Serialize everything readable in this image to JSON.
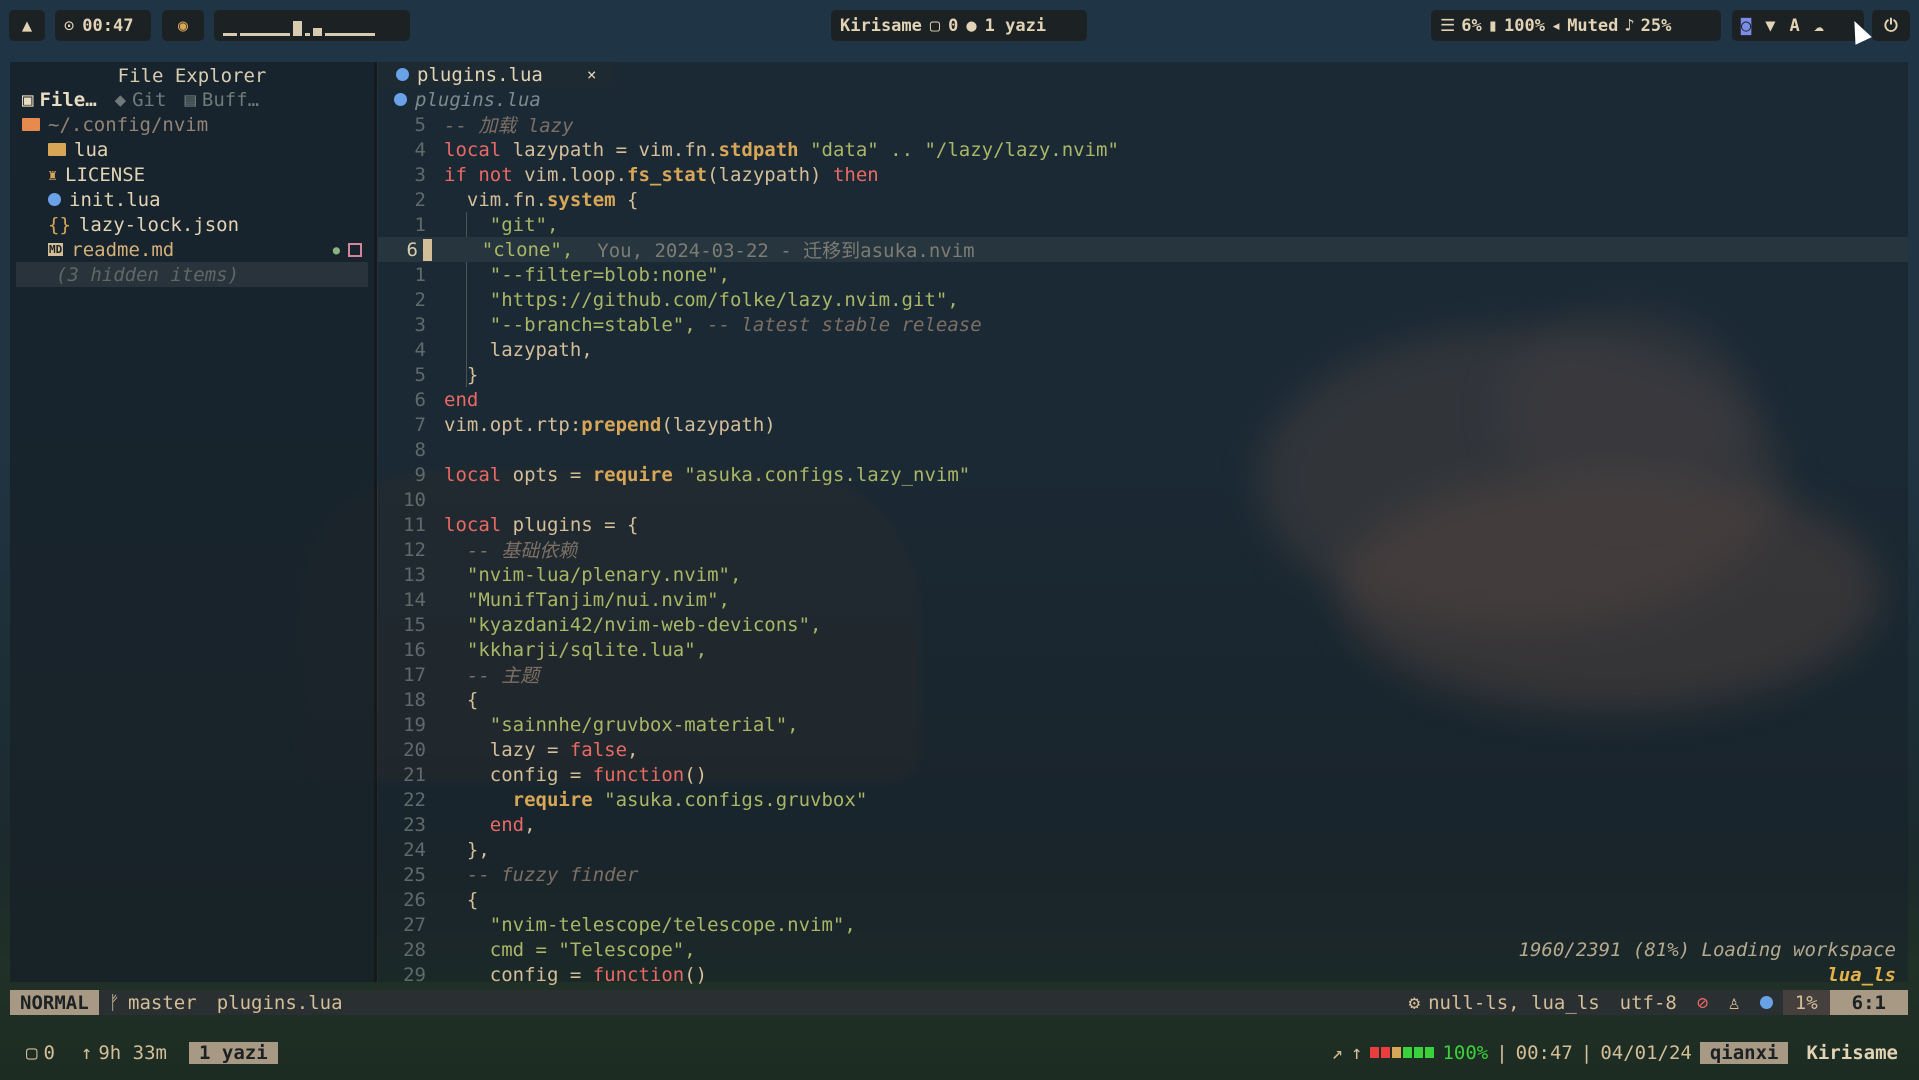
{
  "colors": {
    "accent": "#a89984",
    "keyword": "#ea6962",
    "string": "#a9b665",
    "function": "#d8a657",
    "comment": "#7c6f64",
    "battery_red": "#ea3e3e",
    "battery_green": "#3ad23a"
  },
  "topbar": {
    "clock": "00:47",
    "workspace": "Kirisame",
    "window_count": "0",
    "active_window": "1 yazi",
    "cpu": "6%",
    "battery": "100%",
    "volume": "Muted",
    "mic": "25%",
    "tray_letter": "A"
  },
  "explorer": {
    "title": "File Explorer",
    "tabs": [
      "File…",
      "Git",
      "Buff…"
    ],
    "root": "~/.config/nvim",
    "items": [
      {
        "name": "lua",
        "icon": "folder-icon"
      },
      {
        "name": "LICENSE",
        "icon": "license-icon"
      },
      {
        "name": "init.lua",
        "icon": "lua-file-icon"
      },
      {
        "name": "lazy-lock.json",
        "icon": "json-file-icon"
      },
      {
        "name": "readme.md",
        "icon": "markdown-file-icon"
      }
    ],
    "hidden": "(3 hidden items)"
  },
  "editor": {
    "tab_label": "plugins.lua",
    "tab_close": "×",
    "winbar": "plugins.lua",
    "blame": "You, 2024-03-22 - 迁移到asuka.nvim",
    "loading": "1960/2391 (81%) Loading workspace",
    "loading_server": "lua_ls",
    "line_numbers": [
      "5",
      "4",
      "3",
      "2",
      "1",
      "6",
      "1",
      "2",
      "3",
      "4",
      "5",
      "6",
      "7",
      "8",
      "9",
      "10",
      "11",
      "12",
      "13",
      "14",
      "15",
      "16",
      "17",
      "18",
      "19",
      "20",
      "21",
      "22",
      "23",
      "24",
      "25",
      "26",
      "27",
      "28",
      "29"
    ],
    "lines": [
      [
        "-- 加载 lazy"
      ],
      [
        "local",
        " lazypath = vim.fn.",
        "stdpath",
        " \"data\" .. \"/lazy/lazy.nvim\""
      ],
      [
        "if not",
        " vim.loop.",
        "fs_stat",
        "(lazypath) ",
        "then"
      ],
      [
        "  vim.fn.",
        "system",
        " {"
      ],
      [
        "    \"git\","
      ],
      [
        "    \"clone\","
      ],
      [
        "    \"--filter=blob:none\","
      ],
      [
        "    \"https://github.com/folke/lazy.nvim.git\","
      ],
      [
        "    \"--branch=stable\",",
        " -- latest stable release"
      ],
      [
        "    lazypath,"
      ],
      [
        "  }"
      ],
      [
        "end"
      ],
      [
        "vim.opt.rtp:",
        "prepend",
        "(lazypath)"
      ],
      [
        ""
      ],
      [
        "local",
        " opts = ",
        "require",
        " \"asuka.configs.lazy_nvim\""
      ],
      [
        ""
      ],
      [
        "local",
        " plugins = {"
      ],
      [
        "  -- 基础依赖"
      ],
      [
        "  \"nvim-lua/plenary.nvim\","
      ],
      [
        "  \"MunifTanjim/nui.nvim\","
      ],
      [
        "  \"kyazdani42/nvim-web-devicons\","
      ],
      [
        "  \"kkharji/sqlite.lua\","
      ],
      [
        "  -- 主题"
      ],
      [
        "  {"
      ],
      [
        "    \"sainnhe/gruvbox-material\","
      ],
      [
        "    lazy = ",
        "false",
        ","
      ],
      [
        "    config = ",
        "function",
        "()"
      ],
      [
        "      ",
        "require",
        " \"asuka.configs.gruvbox\""
      ],
      [
        "    ",
        "end",
        ","
      ],
      [
        "  },"
      ],
      [
        "  -- fuzzy finder"
      ],
      [
        "  {"
      ],
      [
        "    \"nvim-telescope/telescope.nvim\","
      ],
      [
        "    cmd = \"Telescope\","
      ],
      [
        "    config = ",
        "function",
        "()"
      ]
    ]
  },
  "statusline": {
    "mode": "NORMAL",
    "branch": "master",
    "file": "plugins.lua",
    "lsp": "null-ls, lua_ls",
    "encoding": "utf-8",
    "percent": "1%",
    "position": "6:1"
  },
  "tmux": {
    "panes": "0",
    "uptime": "9h 33m",
    "window": "1 yazi",
    "battery": "100%",
    "time": "00:47",
    "date": "04/01/24",
    "session": "qianxi",
    "host": "Kirisame"
  }
}
